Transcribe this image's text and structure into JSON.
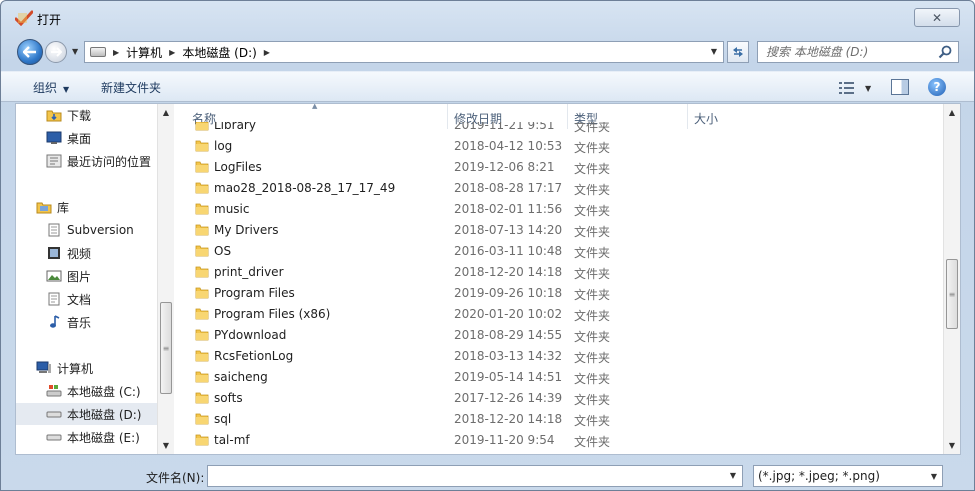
{
  "window": {
    "title": "打开",
    "close_symbol": "✕"
  },
  "nav": {
    "breadcrumbs": [
      "计算机",
      "本地磁盘 (D:)"
    ],
    "search_placeholder": "搜索 本地磁盘 (D:)"
  },
  "toolbar": {
    "organize": "组织",
    "new_folder": "新建文件夹"
  },
  "sidebar": {
    "items": [
      {
        "label": "下载",
        "icon": "download-folder-icon"
      },
      {
        "label": "桌面",
        "icon": "desktop-icon"
      },
      {
        "label": "最近访问的位置",
        "icon": "recent-places-icon"
      },
      {
        "label": "库",
        "icon": "library-icon"
      },
      {
        "label": "Subversion",
        "icon": "document-library-icon"
      },
      {
        "label": "视频",
        "icon": "video-library-icon"
      },
      {
        "label": "图片",
        "icon": "pictures-library-icon"
      },
      {
        "label": "文档",
        "icon": "documents-library-icon"
      },
      {
        "label": "音乐",
        "icon": "music-library-icon"
      },
      {
        "label": "计算机",
        "icon": "computer-icon"
      },
      {
        "label": "本地磁盘 (C:)",
        "icon": "system-drive-icon"
      },
      {
        "label": "本地磁盘 (D:)",
        "icon": "drive-icon"
      },
      {
        "label": "本地磁盘 (E:)",
        "icon": "drive-icon"
      }
    ]
  },
  "columns": {
    "name": "名称",
    "date": "修改日期",
    "type": "类型",
    "size": "大小"
  },
  "files": [
    {
      "name": "Library",
      "date": "2019-11-21 9:51",
      "type": "文件夹"
    },
    {
      "name": "log",
      "date": "2018-04-12 10:53",
      "type": "文件夹"
    },
    {
      "name": "LogFiles",
      "date": "2019-12-06 8:21",
      "type": "文件夹"
    },
    {
      "name": "mao28_2018-08-28_17_17_49",
      "date": "2018-08-28 17:17",
      "type": "文件夹"
    },
    {
      "name": "music",
      "date": "2018-02-01 11:56",
      "type": "文件夹"
    },
    {
      "name": "My Drivers",
      "date": "2018-07-13 14:20",
      "type": "文件夹"
    },
    {
      "name": "OS",
      "date": "2016-03-11 10:48",
      "type": "文件夹"
    },
    {
      "name": "print_driver",
      "date": "2018-12-20 14:18",
      "type": "文件夹"
    },
    {
      "name": "Program Files",
      "date": "2019-09-26 10:18",
      "type": "文件夹"
    },
    {
      "name": "Program Files (x86)",
      "date": "2020-01-20 10:02",
      "type": "文件夹"
    },
    {
      "name": "PYdownload",
      "date": "2018-08-29 14:55",
      "type": "文件夹"
    },
    {
      "name": "RcsFetionLog",
      "date": "2018-03-13 14:32",
      "type": "文件夹"
    },
    {
      "name": "saicheng",
      "date": "2019-05-14 14:51",
      "type": "文件夹"
    },
    {
      "name": "softs",
      "date": "2017-12-26 14:39",
      "type": "文件夹"
    },
    {
      "name": "sql",
      "date": "2018-12-20 14:18",
      "type": "文件夹"
    },
    {
      "name": "tal-mf",
      "date": "2019-11-20 9:54",
      "type": "文件夹"
    }
  ],
  "bottom": {
    "filename_label": "文件名(N):",
    "filename_value": "",
    "filter": "(*.jpg; *.jpeg; *.png)"
  }
}
